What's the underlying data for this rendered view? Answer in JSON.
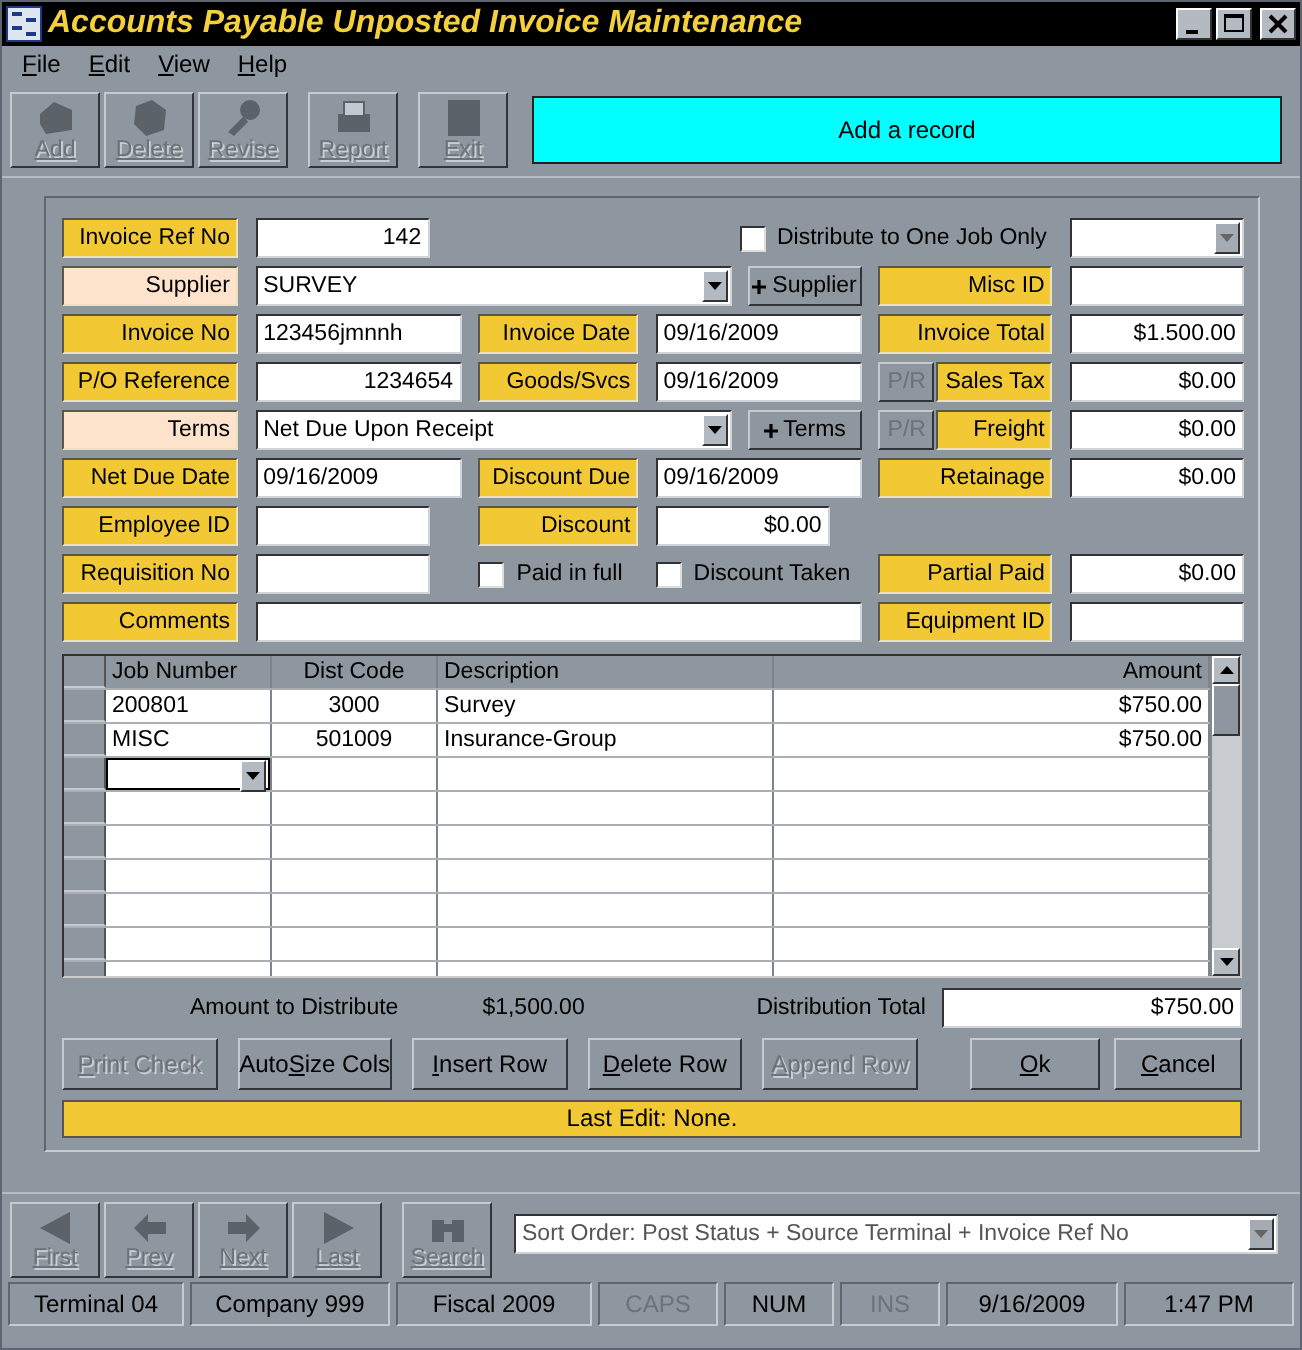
{
  "window": {
    "title": "Accounts Payable Unposted Invoice Maintenance"
  },
  "menu": [
    "File",
    "Edit",
    "View",
    "Help"
  ],
  "toolbar": [
    {
      "label": "Add",
      "kind": "add",
      "disabled": true
    },
    {
      "label": "Delete",
      "kind": "delete",
      "disabled": true
    },
    {
      "label": "Revise",
      "kind": "revise",
      "disabled": true
    },
    {
      "label": "Report",
      "kind": "report",
      "disabled": true
    },
    {
      "label": "Exit",
      "kind": "exit",
      "disabled": true
    }
  ],
  "message": "Add a record",
  "form": {
    "invoice_ref": {
      "label": "Invoice Ref No",
      "lookup": false,
      "value": "142"
    },
    "distribute": {
      "label": "Distribute to One Job Only",
      "checked": false
    },
    "supplier": {
      "label": "Supplier",
      "lookup": true,
      "value": "SURVEY",
      "button": "Supplier"
    },
    "misc_id": {
      "label": "Misc ID",
      "lookup": false
    },
    "invoice_no": {
      "label": "Invoice No",
      "lookup": false,
      "value": "123456jmnnh"
    },
    "invoice_date": {
      "label": "Invoice Date",
      "lookup": false,
      "value": "09/16/2009"
    },
    "invoice_total": {
      "label": "Invoice Total",
      "lookup": false,
      "value": "$1.500.00"
    },
    "po_reference": {
      "label": "P/O Reference",
      "lookup": false,
      "value": "1234654"
    },
    "goods_svcs": {
      "label": "Goods/Svcs",
      "lookup": false,
      "value": "09/16/2009"
    },
    "sales_tax": {
      "label": "Sales Tax",
      "lookup": false,
      "value": "$0.00",
      "pr": "P/R",
      "pr_disabled": true
    },
    "terms": {
      "label": "Terms",
      "lookup": true,
      "value": "Net Due Upon Receipt",
      "button": "Terms"
    },
    "freight": {
      "label": "Freight",
      "lookup": false,
      "value": "$0.00",
      "pr": "P/R",
      "pr_disabled": true
    },
    "net_due_date": {
      "label": "Net Due Date",
      "lookup": false,
      "value": "09/16/2009"
    },
    "discount_due": {
      "label": "Discount Due",
      "lookup": false,
      "value": "09/16/2009"
    },
    "retainage": {
      "label": "Retainage",
      "lookup": false,
      "value": "$0.00"
    },
    "employee_id": {
      "label": "Employee ID",
      "lookup": false
    },
    "discount": {
      "label": "Discount",
      "lookup": false,
      "value": "$0.00"
    },
    "requisition_no": {
      "label": "Requisition No",
      "lookup": false
    },
    "paid_in_full": {
      "label": "Paid in full",
      "checked": false
    },
    "discount_taken": {
      "label": "Discount Taken",
      "checked": false
    },
    "partial_paid": {
      "label": "Partial Paid",
      "lookup": false,
      "value": "$0.00"
    },
    "comments": {
      "label": "Comments",
      "lookup": false
    },
    "equipment_id": {
      "label": "Equipment ID",
      "lookup": false
    }
  },
  "table": {
    "columns": [
      "Job Number",
      "Dist Code",
      "Description",
      "Amount"
    ],
    "rows": [
      [
        "200801",
        "3000",
        "Survey",
        "$750.00"
      ],
      [
        "MISC",
        "501009",
        "Insurance-Group",
        "$750.00"
      ]
    ]
  },
  "summary": {
    "amount_label": "Amount to Distribute",
    "amount": "$1,500.00",
    "total_label": "Distribution Total",
    "total": "$750.00"
  },
  "buttons": [
    {
      "label": "Print Check",
      "disabled": true
    },
    {
      "label": "AutoSize Cols",
      "disabled": false
    },
    {
      "label": "Insert Row",
      "disabled": false
    },
    {
      "label": "Delete Row",
      "disabled": false
    },
    {
      "label": "Append Row",
      "disabled": true
    },
    {
      "label": "Ok",
      "disabled": false
    },
    {
      "label": "Cancel",
      "disabled": false
    }
  ],
  "last_edit": "Last Edit: None.",
  "nav": [
    {
      "label": "First",
      "kind": "first",
      "disabled": true
    },
    {
      "label": "Prev",
      "kind": "prev",
      "disabled": true
    },
    {
      "label": "Next",
      "kind": "next",
      "disabled": true
    },
    {
      "label": "Last",
      "kind": "last",
      "disabled": true
    },
    {
      "label": "Search",
      "kind": "search",
      "disabled": true
    }
  ],
  "sort_order": "Sort Order: Post Status + Source Terminal + Invoice Ref No",
  "status_bar": [
    {
      "text": "Terminal 04",
      "disabled": false
    },
    {
      "text": "Company 999",
      "disabled": false
    },
    {
      "text": "Fiscal 2009",
      "disabled": false
    },
    {
      "text": "CAPS",
      "disabled": true
    },
    {
      "text": "NUM",
      "disabled": false
    },
    {
      "text": "INS",
      "disabled": true
    },
    {
      "text": "9/16/2009",
      "disabled": false
    },
    {
      "text": "1:47 PM",
      "disabled": false
    }
  ]
}
